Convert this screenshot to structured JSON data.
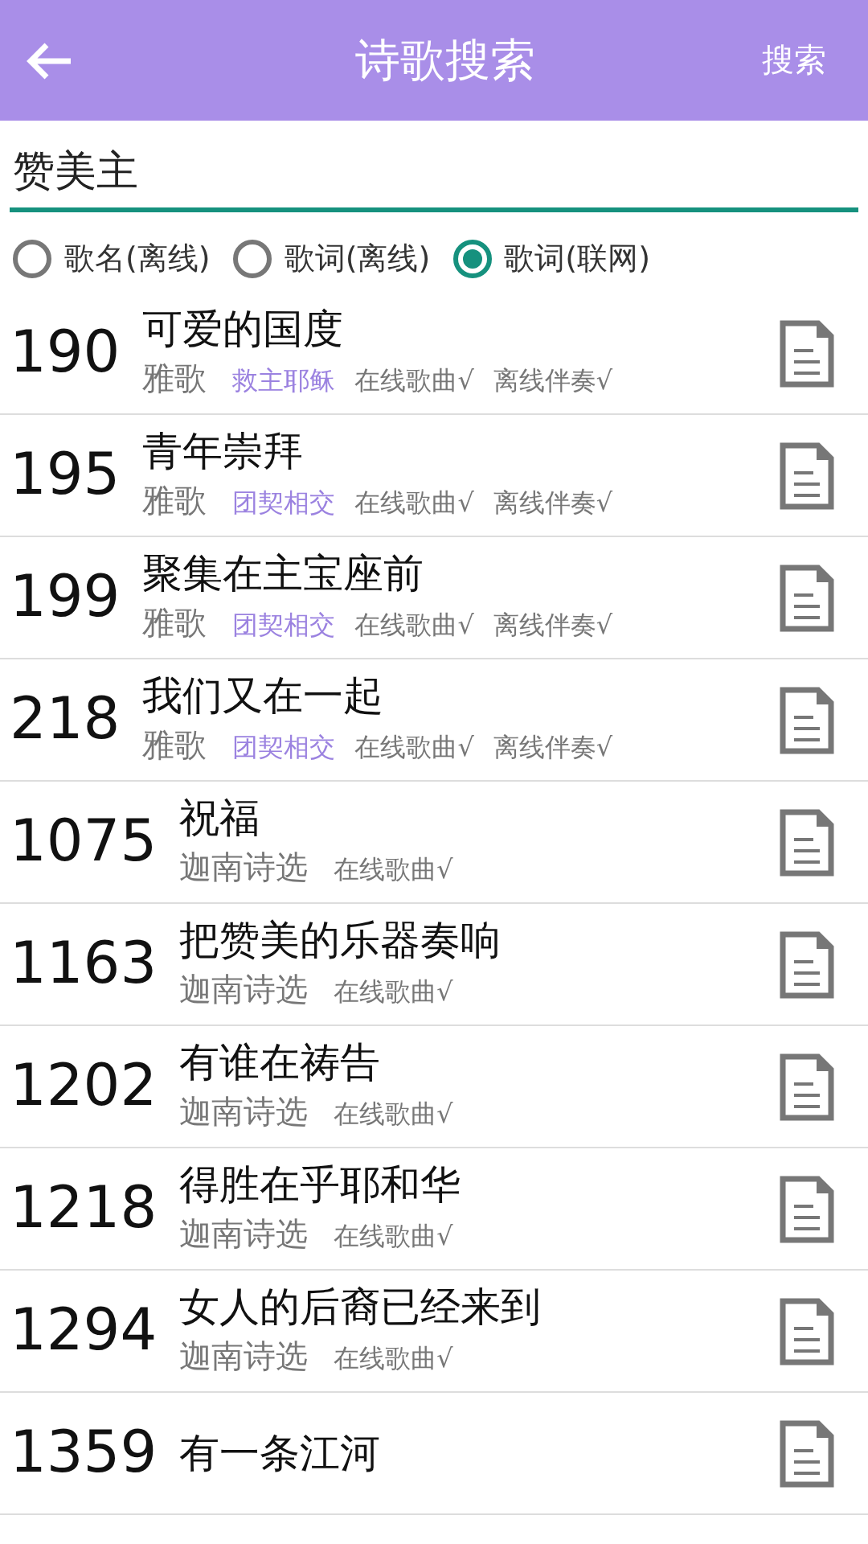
{
  "header": {
    "title": "诗歌搜索",
    "action": "搜索"
  },
  "search": {
    "value": "赞美主"
  },
  "modes": [
    {
      "label": "歌名(离线)",
      "selected": false
    },
    {
      "label": "歌词(离线)",
      "selected": false
    },
    {
      "label": "歌词(联网)",
      "selected": true
    }
  ],
  "results": [
    {
      "number": "190",
      "title": "可爱的国度",
      "book": "雅歌",
      "meta": [
        {
          "text": "救主耶稣",
          "kind": "collection"
        },
        {
          "text": "在线歌曲√",
          "kind": "status"
        },
        {
          "text": "离线伴奏√",
          "kind": "status"
        }
      ]
    },
    {
      "number": "195",
      "title": "青年崇拜",
      "book": "雅歌",
      "meta": [
        {
          "text": "团契相交",
          "kind": "collection"
        },
        {
          "text": "在线歌曲√",
          "kind": "status"
        },
        {
          "text": "离线伴奏√",
          "kind": "status"
        }
      ]
    },
    {
      "number": "199",
      "title": "聚集在主宝座前",
      "book": "雅歌",
      "meta": [
        {
          "text": "团契相交",
          "kind": "collection"
        },
        {
          "text": "在线歌曲√",
          "kind": "status"
        },
        {
          "text": "离线伴奏√",
          "kind": "status"
        }
      ]
    },
    {
      "number": "218",
      "title": "我们又在一起",
      "book": "雅歌",
      "meta": [
        {
          "text": "团契相交",
          "kind": "collection"
        },
        {
          "text": "在线歌曲√",
          "kind": "status"
        },
        {
          "text": "离线伴奏√",
          "kind": "status"
        }
      ]
    },
    {
      "number": "1075",
      "title": "祝福",
      "book": "迦南诗选",
      "meta": [
        {
          "text": "在线歌曲√",
          "kind": "status"
        }
      ]
    },
    {
      "number": "1163",
      "title": "把赞美的乐器奏响",
      "book": "迦南诗选",
      "meta": [
        {
          "text": "在线歌曲√",
          "kind": "status"
        }
      ]
    },
    {
      "number": "1202",
      "title": "有谁在祷告",
      "book": "迦南诗选",
      "meta": [
        {
          "text": "在线歌曲√",
          "kind": "status"
        }
      ]
    },
    {
      "number": "1218",
      "title": "得胜在乎耶和华",
      "book": "迦南诗选",
      "meta": [
        {
          "text": "在线歌曲√",
          "kind": "status"
        }
      ]
    },
    {
      "number": "1294",
      "title": "女人的后裔已经来到",
      "book": "迦南诗选",
      "meta": [
        {
          "text": "在线歌曲√",
          "kind": "status"
        }
      ]
    },
    {
      "number": "1359",
      "title": "有一条江河"
    }
  ]
}
